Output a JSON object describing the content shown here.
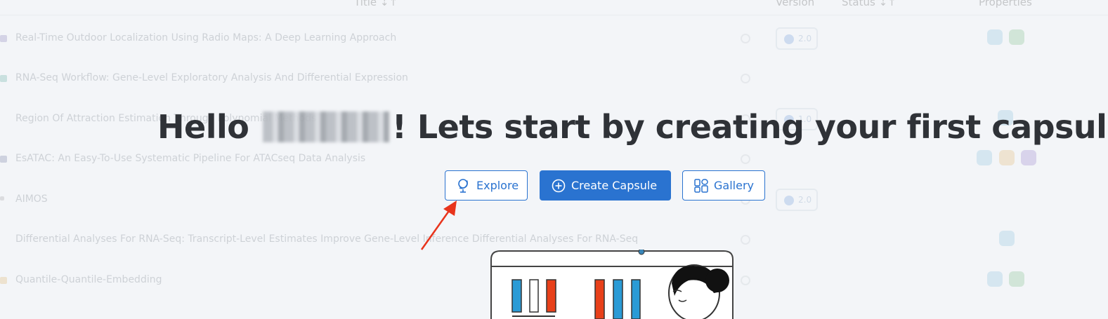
{
  "table_header": {
    "title": "Title ⇣↑",
    "version": "Version",
    "status": "Status ⇣↑",
    "properties": "Properties"
  },
  "rows": [
    {
      "title": "Real-Time Outdoor Localization Using Radio Maps: A Deep Learning Approach",
      "version": "2.0"
    },
    {
      "title": "RNA-Seq Workflow: Gene-Level Exploratory Analysis And Differential Expression",
      "version": ""
    },
    {
      "title": "Region Of Attraction Estimation Through Polynomial Methods",
      "version": "1.0"
    },
    {
      "title": "EsATAC: An Easy-To-Use Systematic Pipeline For ATACseq Data Analysis",
      "version": ""
    },
    {
      "title": "AIMOS",
      "version": "2.0"
    },
    {
      "title": "Differential Analyses For RNA-Seq: Transcript-Level Estimates Improve Gene-Level Inference Differential Analyses For RNA-Seq",
      "version": ""
    },
    {
      "title": "Quantile-Quantile-Embedding",
      "version": ""
    }
  ],
  "headline": {
    "hello": "Hello",
    "rest": "! Lets start by creating your first capsule"
  },
  "buttons": {
    "explore": "Explore",
    "create": "Create Capsule",
    "gallery": "Gallery"
  },
  "colors": {
    "primary": "#2a73d0",
    "headline": "#2f3237",
    "annotation_arrow": "#e8341c"
  },
  "icons": {
    "explore": "globe-icon",
    "create": "plus-circle-icon",
    "gallery": "grid-icon"
  }
}
